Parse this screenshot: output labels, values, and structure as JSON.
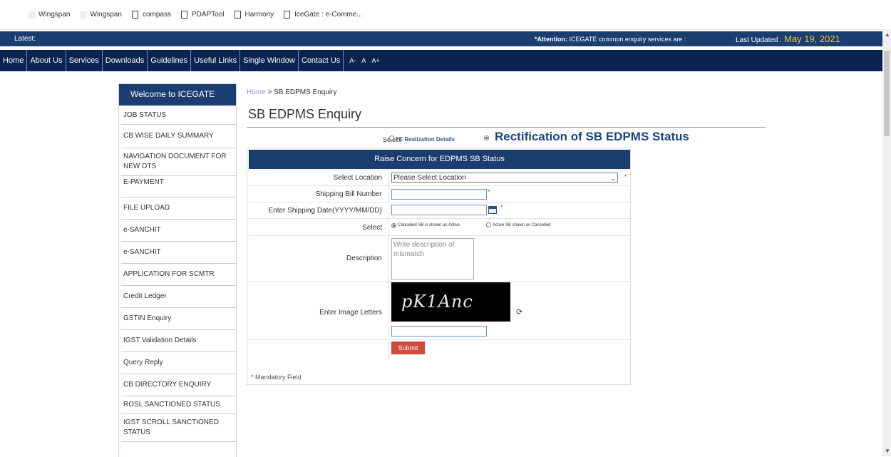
{
  "bookmarks": [
    "Wingspan",
    "Wingspan",
    "compass",
    "PDAPTool",
    "Harmony",
    "IceGate : e-Comme..."
  ],
  "ticker": {
    "latest_label": "Latest:",
    "attention_label": "*Attention:",
    "attention_text": "ICEGATE common enquiry services are :",
    "updated_label": "Last Updated :",
    "updated_date": "May 19, 2021"
  },
  "nav": {
    "items": [
      "Home",
      "About Us",
      "Services",
      "Downloads",
      "Guidelines",
      "Useful Links",
      "Single Window",
      "Contact Us"
    ],
    "font_sizes": [
      "A-",
      "A",
      "A+"
    ]
  },
  "sidebar": {
    "header": "Welcome to ICEGATE",
    "items": [
      "JOB STATUS",
      "CB WISE DAILY SUMMARY",
      "NAVIGATION DOCUMENT FOR NEW DTS",
      "E-PAYMENT",
      "FILE UPLOAD",
      "e-SANCHIT",
      "e-SANCHIT",
      "APPLICATION FOR SCMTR",
      "Credit Ledger",
      "GSTIN Enquiry",
      "IGST Validation Details",
      "Query Reply",
      "CB DIRECTORY ENQUIRY",
      "ROSL SANCTIONED STATUS",
      "IGST SCROLL SANCTIONED STATUS"
    ]
  },
  "breadcrumb": {
    "home": "Home",
    "sep": " > ",
    "current": "SB EDPMS Enquiry"
  },
  "page_title": "SB EDPMS Enquiry",
  "select_type": {
    "label": "Select",
    "option1": "FE Realization Details",
    "option2": "Rectification of SB EDPMS Status",
    "selected": "option2"
  },
  "form": {
    "header": "Raise Concern for EDPMS SB Status",
    "location_label": "Select Location",
    "location_value": "Please Select Location",
    "sb_number_label": "Shipping Bill Number",
    "sb_number_value": "",
    "date_label": "Enter Shipping Date(YYYY/MM/DD)",
    "date_value": "",
    "status_label": "Select",
    "status_opt1": "Cancelled SB is shown as Active",
    "status_opt2": "Active SB shown as Cancelled",
    "status_selected": "opt1",
    "description_label": "Description",
    "description_placeholder": "Write description of mismatch",
    "captcha_label": "Enter Image Letters",
    "captcha_text": "pK1Anc",
    "captcha_value": "",
    "submit_label": "Submit",
    "mandatory_note": "* Mandatory Field",
    "required_mark": "*"
  },
  "colors": {
    "header_blue": "#1a3e6f",
    "nav_blue": "#0b2350",
    "accent_gold": "#e8c54a",
    "submit_red": "#d24a3a"
  }
}
